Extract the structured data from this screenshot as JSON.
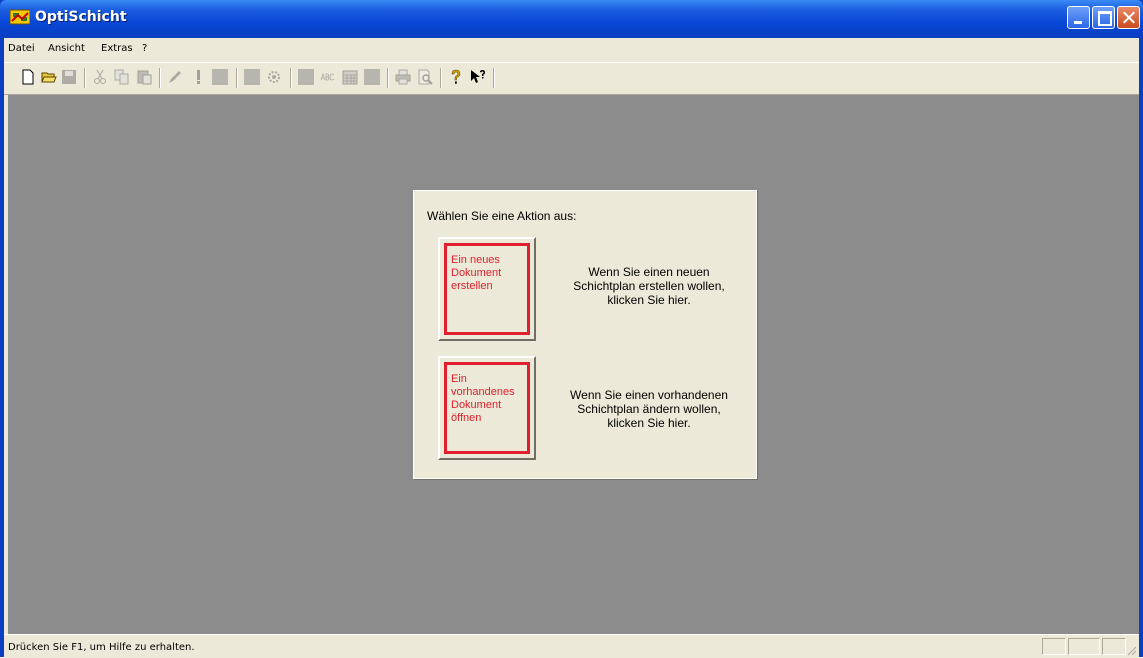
{
  "window": {
    "title": "OptiSchicht",
    "controls": [
      "minimize-icon",
      "maximize-icon",
      "close-icon"
    ]
  },
  "menubar": {
    "items": [
      {
        "label": "Datei"
      },
      {
        "label": "Ansicht"
      },
      {
        "label": "Extras"
      },
      {
        "label": "?"
      }
    ]
  },
  "toolbar": {
    "buttons": [
      {
        "icon": "new-document-icon",
        "enabled": true
      },
      {
        "icon": "open-folder-icon",
        "enabled": true
      },
      {
        "icon": "save-icon",
        "enabled": false
      },
      {
        "icon": "cut-icon",
        "enabled": false
      },
      {
        "icon": "copy-icon",
        "enabled": false
      },
      {
        "icon": "paste-icon",
        "enabled": false
      },
      {
        "icon": "pencil-icon",
        "enabled": false
      },
      {
        "icon": "exclamation-icon",
        "enabled": false
      },
      {
        "icon": "square-icon",
        "enabled": false
      },
      {
        "icon": "square-icon",
        "enabled": false
      },
      {
        "icon": "gear-icon",
        "enabled": false
      },
      {
        "icon": "square-icon",
        "enabled": false
      },
      {
        "icon": "abc-icon",
        "enabled": false
      },
      {
        "icon": "calendar-icon",
        "enabled": false
      },
      {
        "icon": "square-icon",
        "enabled": false
      },
      {
        "icon": "print-icon",
        "enabled": false
      },
      {
        "icon": "print-preview-icon",
        "enabled": false
      },
      {
        "icon": "help-icon",
        "enabled": true
      },
      {
        "icon": "context-help-icon",
        "enabled": true
      }
    ]
  },
  "dialog": {
    "prompt": "Wählen Sie eine Aktion aus:",
    "actions": [
      {
        "button_label": "Ein neues\nDokument\nerstellen",
        "description": "Wenn Sie einen neuen\nSchichtplan erstellen wollen,\nklicken Sie hier."
      },
      {
        "button_label": "Ein\nvorhandenes\nDokument\nöffnen",
        "description": "Wenn Sie einen vorhandenen\nSchichtplan ändern wollen,\nklicken Sie hier."
      }
    ],
    "accent_color": "#e0202e"
  },
  "statusbar": {
    "text": "Drücken Sie F1, um Hilfe zu erhalten."
  },
  "colors": {
    "workspace": "#8c8c8c",
    "face": "#ece9d8",
    "titlebar": "#0847d6"
  }
}
